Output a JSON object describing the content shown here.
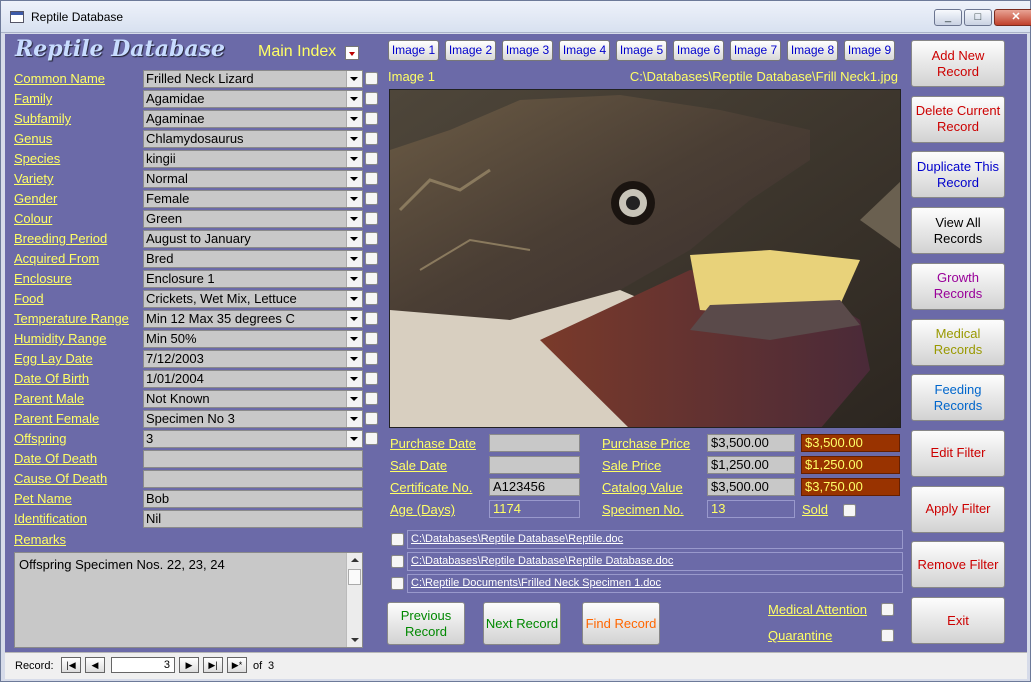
{
  "window": {
    "title": "Reptile Database",
    "minimize": "0",
    "maximize": "1",
    "close": "r"
  },
  "header": {
    "title": "Reptile Database",
    "main_index": "Main Index"
  },
  "fields": [
    {
      "label": "Common Name",
      "value": "Frilled Neck Lizard"
    },
    {
      "label": "Family",
      "value": "Agamidae"
    },
    {
      "label": "Subfamily",
      "value": "Agaminae"
    },
    {
      "label": "Genus",
      "value": "Chlamydosaurus"
    },
    {
      "label": "Species",
      "value": "kingii"
    },
    {
      "label": "Variety",
      "value": "Normal"
    },
    {
      "label": "Gender",
      "value": "Female"
    },
    {
      "label": "Colour",
      "value": "Green"
    },
    {
      "label": "Breeding Period",
      "value": "August to January"
    },
    {
      "label": "Acquired From",
      "value": "Bred"
    },
    {
      "label": "Enclosure",
      "value": "Enclosure 1"
    },
    {
      "label": "Food",
      "value": "Crickets, Wet Mix, Lettuce"
    },
    {
      "label": "Temperature Range",
      "value": "Min 12 Max 35 degrees C"
    },
    {
      "label": "Humidity Range",
      "value": "Min 50%"
    },
    {
      "label": "Egg Lay Date",
      "value": "7/12/2003"
    },
    {
      "label": "Date Of Birth",
      "value": "1/01/2004"
    },
    {
      "label": "Parent Male",
      "value": "Not Known"
    },
    {
      "label": "Parent Female",
      "value": "Specimen No 3"
    },
    {
      "label": "Offspring",
      "value": "3"
    },
    {
      "label": "Date Of Death",
      "value": ""
    },
    {
      "label": "Cause Of Death",
      "value": ""
    },
    {
      "label": "Pet Name",
      "value": "Bob"
    },
    {
      "label": "Identification",
      "value": "Nil"
    }
  ],
  "remarks": {
    "label": "Remarks",
    "value": "Offspring Specimen Nos. 22, 23, 24"
  },
  "image_buttons": [
    "Image 1",
    "Image 2",
    "Image 3",
    "Image 4",
    "Image 5",
    "Image 6",
    "Image 7",
    "Image 8",
    "Image 9"
  ],
  "image": {
    "label": "Image 1",
    "path": "C:\\Databases\\Reptile Database\\Frill Neck1.jpg"
  },
  "purchase": {
    "purchase_date_label": "Purchase Date",
    "purchase_date": "",
    "sale_date_label": "Sale Date",
    "sale_date": "",
    "certificate_label": "Certificate No.",
    "certificate": "A123456",
    "age_label": "Age (Days)",
    "age": "1174",
    "purchase_price_label": "Purchase Price",
    "purchase_price": "$3,500.00",
    "purchase_price_alt": "$3,500.00",
    "sale_price_label": "Sale Price",
    "sale_price": "$1,250.00",
    "sale_price_alt": "$1,250.00",
    "catalog_value_label": "Catalog Value",
    "catalog_value": "$3,500.00",
    "catalog_value_alt": "$3,750.00",
    "specimen_label": "Specimen No.",
    "specimen": "13",
    "sold_label": "Sold"
  },
  "documents": [
    "C:\\Databases\\Reptile Database\\Reptile.doc",
    "C:\\Databases\\Reptile Database\\Reptile Database.doc",
    "C:\\Reptile Documents\\Frilled Neck Specimen 1.doc"
  ],
  "bottom_buttons": {
    "previous": "Previous Record",
    "next": "Next Record",
    "find": "Find Record"
  },
  "flags": {
    "medical_attention": "Medical Attention",
    "quarantine": "Quarantine"
  },
  "side_buttons": [
    {
      "label": "Add New Record",
      "color": "#cc0000"
    },
    {
      "label": "Delete Current Record",
      "color": "#cc0000"
    },
    {
      "label": "Duplicate This Record",
      "color": "#0000cc"
    },
    {
      "label": "View All Records",
      "color": "#000000"
    },
    {
      "label": "Growth Records",
      "color": "#990099"
    },
    {
      "label": "Medical Records",
      "color": "#999900"
    },
    {
      "label": "Feeding Records",
      "color": "#0066cc"
    },
    {
      "label": "Edit Filter",
      "color": "#cc0000"
    },
    {
      "label": "Apply Filter",
      "color": "#cc0000"
    },
    {
      "label": "Remove Filter",
      "color": "#cc0000"
    },
    {
      "label": "Exit",
      "color": "#cc0000"
    }
  ],
  "navigation": {
    "label": "Record:",
    "current": "3",
    "of": "of",
    "total": "3"
  },
  "colors": {
    "form_bg": "#6b6aa8",
    "label_yellow": "#ffff66",
    "price_red": "#993300"
  }
}
